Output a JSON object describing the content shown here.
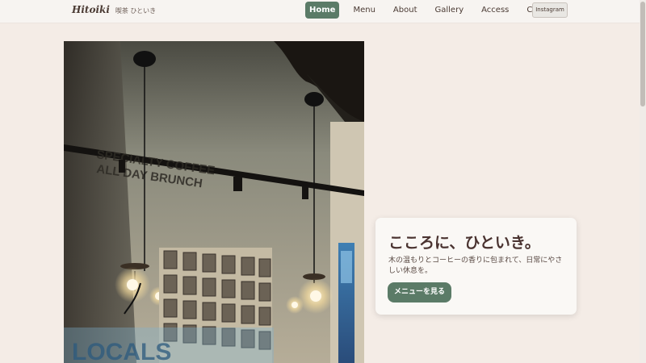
{
  "header": {
    "brand": "Hitoiki",
    "brand_sub": "喫茶 ひといき",
    "nav": [
      "Home",
      "Menu",
      "About",
      "Gallery",
      "Access",
      "Contact"
    ],
    "active_nav": "Home",
    "instagram": "Instagram"
  },
  "hero": {
    "photo_sign_line1": "SPECIALTY COFFEE",
    "photo_sign_line2": "ALL DAY BRUNCH",
    "photo_window_text": "LOCALS",
    "title": "こころに、ひといき。",
    "text": "木の温もりとコーヒーの香りに包まれて、日常にやさしい休息を。",
    "button": "メニューを見る"
  },
  "colors": {
    "accent": "#5b7b67",
    "page_bg": "#f4ece6",
    "text": "#4a3a33"
  }
}
